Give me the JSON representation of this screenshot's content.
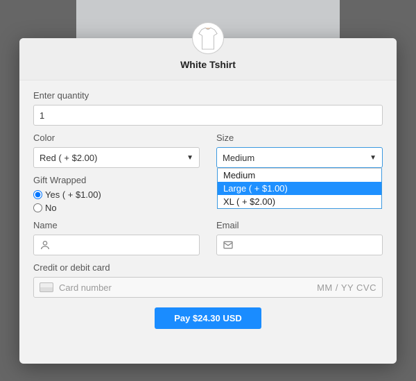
{
  "product": {
    "title": "White Tshirt"
  },
  "quantity": {
    "label": "Enter quantity",
    "value": "1"
  },
  "color": {
    "label": "Color",
    "selected": "Red ( + $2.00)"
  },
  "size": {
    "label": "Size",
    "selected": "Medium",
    "options": [
      "Medium",
      "Large ( + $1.00)",
      "XL ( + $2.00)"
    ],
    "highlighted_index": 1
  },
  "gift": {
    "label": "Gift Wrapped",
    "yes_label": "Yes ( + $1.00)",
    "no_label": "No",
    "selected": "yes"
  },
  "name": {
    "label": "Name"
  },
  "email": {
    "label": "Email"
  },
  "card": {
    "label": "Credit or debit card",
    "placeholder": "Card number",
    "right": "MM / YY  CVC"
  },
  "pay": {
    "label": "Pay $24.30 USD"
  }
}
